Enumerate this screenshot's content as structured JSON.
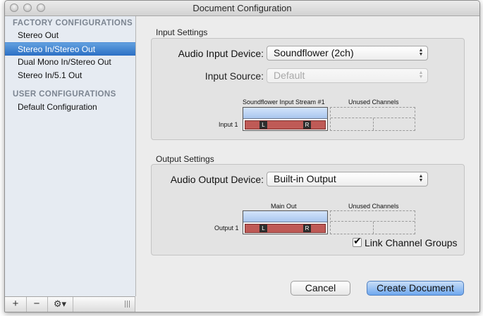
{
  "window": {
    "title": "Document Configuration"
  },
  "sidebar": {
    "factory_heading": "FACTORY CONFIGURATIONS",
    "factory_items": [
      {
        "label": "Stereo Out",
        "selected": false
      },
      {
        "label": "Stereo In/Stereo Out",
        "selected": true
      },
      {
        "label": "Dual Mono In/Stereo Out",
        "selected": false
      },
      {
        "label": "Stereo In/5.1 Out",
        "selected": false
      }
    ],
    "user_heading": "USER CONFIGURATIONS",
    "user_items": [
      {
        "label": "Default Configuration"
      }
    ],
    "toolbar": {
      "add": "+",
      "remove": "−",
      "gear": "⚙▾"
    }
  },
  "input": {
    "group_label": "Input Settings",
    "device_label": "Audio Input Device:",
    "device_value": "Soundflower (2ch)",
    "source_label": "Input Source:",
    "source_value": "Default",
    "stream_label": "Soundflower Input Stream #1",
    "unused_label": "Unused Channels",
    "row_label": "Input 1",
    "left_ch": "L",
    "right_ch": "R"
  },
  "output": {
    "group_label": "Output Settings",
    "device_label": "Audio Output Device:",
    "device_value": "Built-in Output",
    "stream_label": "Main Out",
    "unused_label": "Unused Channels",
    "row_label": "Output 1",
    "left_ch": "L",
    "right_ch": "R",
    "link_label": "Link Channel Groups",
    "link_checked": true
  },
  "buttons": {
    "cancel": "Cancel",
    "create": "Create Document"
  },
  "colors": {
    "selection": "#3d82d4",
    "channel_bar": "#bf5a56",
    "default_button": "#6fa8ef"
  },
  "icons": {
    "popup": "up-down-arrows-icon",
    "check": "checkmark-icon",
    "gear": "gear-icon"
  }
}
